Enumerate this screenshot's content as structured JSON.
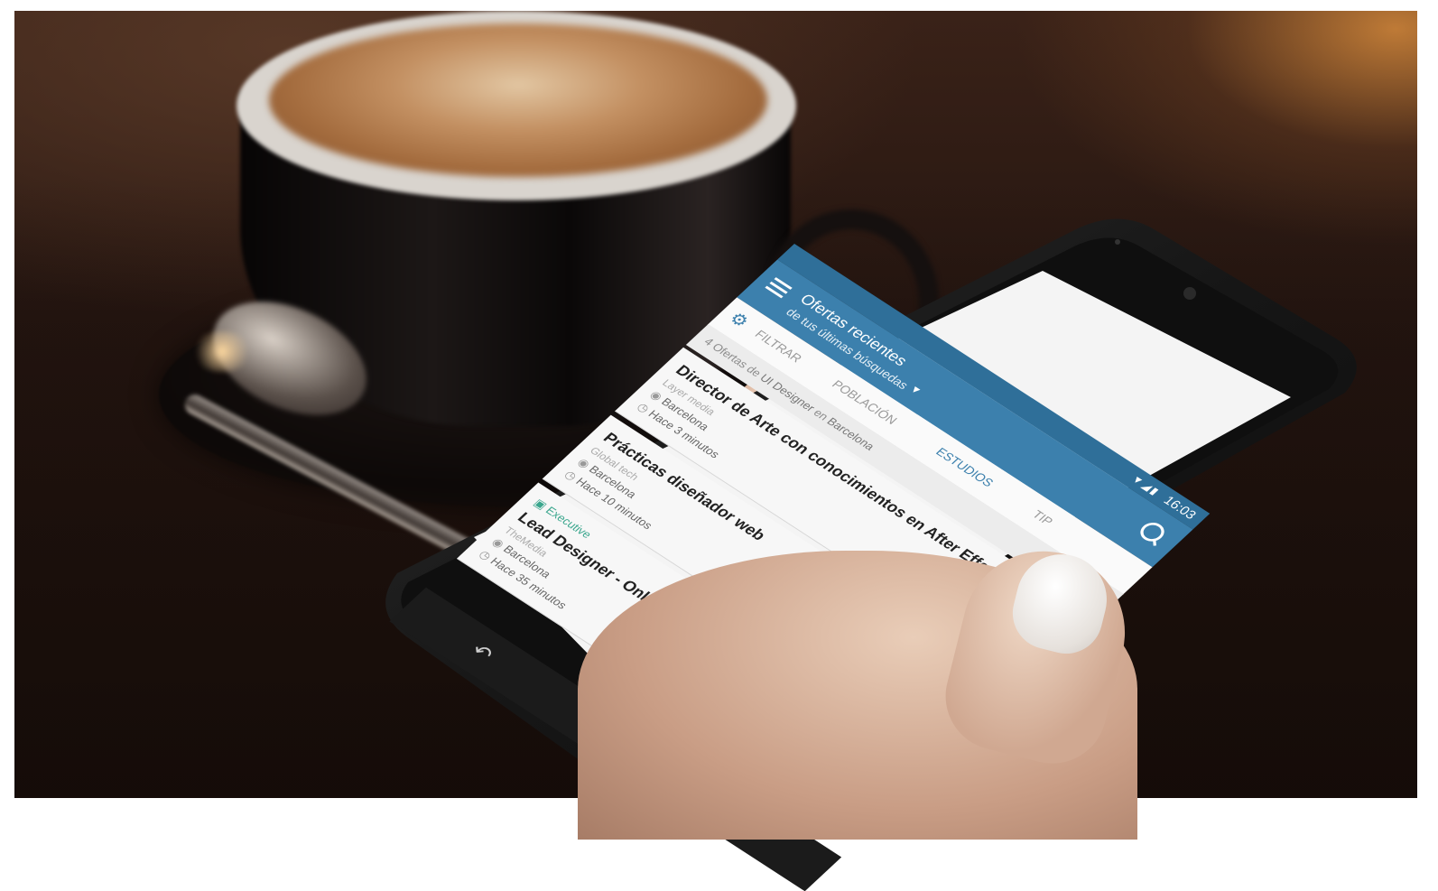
{
  "status_bar": {
    "time": "16:03",
    "signal_icon": "signal-icon",
    "battery_icon": "battery-icon"
  },
  "app_bar": {
    "title": "Ofertas recientes",
    "subtitle": "de tus últimas búsquedas",
    "menu_icon": "menu-icon",
    "search_icon": "search-icon"
  },
  "tabs": {
    "filter_label": "FILTRAR",
    "items": [
      {
        "label": "POBLACIÓN"
      },
      {
        "label": "ESTUDIOS"
      },
      {
        "label": "TIP"
      }
    ],
    "active": "ESTUDIOS"
  },
  "summary": {
    "count": "4",
    "text_a": "Ofertas de",
    "query": "UI Designer",
    "text_b": "en",
    "location": "Barcelona"
  },
  "jobs": [
    {
      "title": "Director de Arte con conocimientos en After Effects",
      "company": "Layer media",
      "location": "Barcelona",
      "time": "Hace 3 minutos"
    },
    {
      "title": "Prácticas diseñador web",
      "company": "Global tech",
      "location": "Barcelona",
      "time": "Hace 10 minutos"
    },
    {
      "badge": "Executive",
      "title": "Lead Designer - Online/Offline. Freelance Part time",
      "company": "TheMedia",
      "location": "Barcelona",
      "time": "Hace 35 minutos"
    }
  ],
  "nav_bar": {
    "back_icon": "back-icon",
    "home_icon": "home-icon",
    "recents_icon": "recents-icon"
  }
}
